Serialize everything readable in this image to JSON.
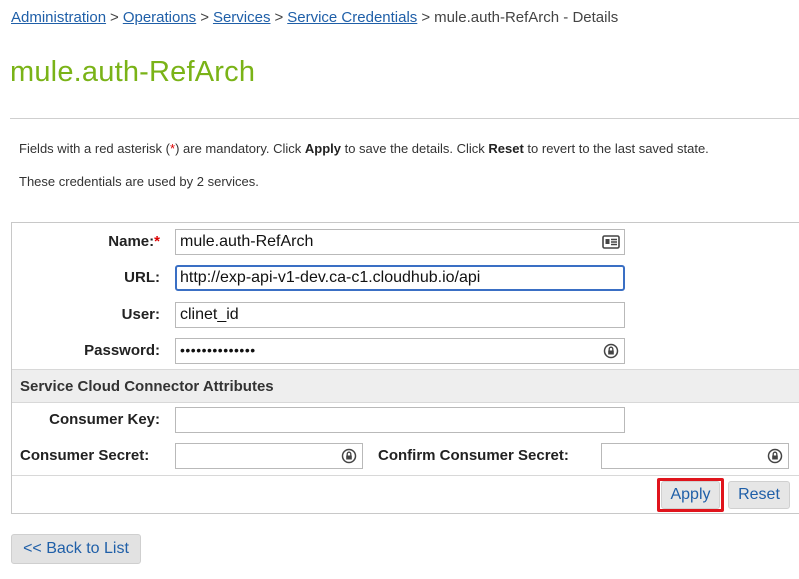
{
  "breadcrumb": {
    "items": [
      "Administration",
      "Operations",
      "Services",
      "Service Credentials"
    ],
    "separator": ">",
    "current": "mule.auth-RefArch - Details"
  },
  "page": {
    "title": "mule.auth-RefArch"
  },
  "info": {
    "line1_prefix": "Fields with a red asterisk (",
    "asterisk": "*",
    "line1_mid1": ") are mandatory. Click ",
    "apply_word": "Apply",
    "line1_mid2": " to save the details. Click ",
    "reset_word": "Reset",
    "line1_suffix": " to revert to the last saved state.",
    "line2": "These credentials are used by 2 services."
  },
  "form": {
    "name": {
      "label": "Name:",
      "required_mark": "*",
      "value": "mule.auth-RefArch",
      "icon": "contact-card-icon"
    },
    "url": {
      "label": "URL:",
      "value": "http://exp-api-v1-dev.ca-c1.cloudhub.io/api"
    },
    "user": {
      "label": "User:",
      "value": "clinet_id"
    },
    "password": {
      "label": "Password:",
      "value": "••••••••••••••",
      "icon": "password-reveal-icon"
    },
    "section_title": "Service Cloud Connector Attributes",
    "consumer_key": {
      "label": "Consumer Key:",
      "value": ""
    },
    "consumer_secret": {
      "label": "Consumer Secret:",
      "value": "",
      "icon": "password-reveal-icon"
    },
    "confirm_consumer_secret": {
      "label": "Confirm Consumer Secret:",
      "value": "",
      "icon": "password-reveal-icon"
    }
  },
  "actions": {
    "apply": "Apply",
    "reset": "Reset",
    "back": "<< Back to List"
  },
  "colors": {
    "title_green": "#7ab317",
    "link_blue": "#1f5fa8",
    "required_red": "#d00000",
    "highlight_red": "#e0141c",
    "focus_blue": "#3a6fc4"
  }
}
